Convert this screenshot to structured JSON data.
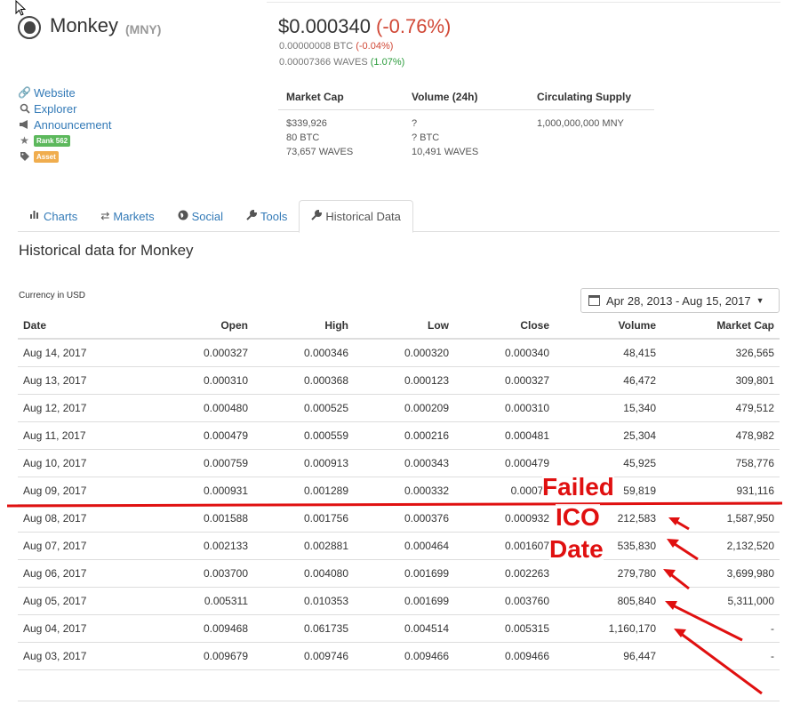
{
  "coin": {
    "name": "Monkey",
    "symbol": "(MNY)",
    "price": "$0.000340",
    "price_change": "(-0.76%)",
    "btc_price": "0.00000008 BTC",
    "btc_change": "(-0.04%)",
    "waves_price": "0.00007366 WAVES",
    "waves_change": "(1.07%)"
  },
  "links": {
    "website": "Website",
    "explorer": "Explorer",
    "announcement": "Announcement",
    "rank": "Rank 562",
    "asset": "Asset"
  },
  "stats": {
    "headers": [
      "Market Cap",
      "Volume (24h)",
      "Circulating Supply"
    ],
    "market_cap": [
      "$339,926",
      "80 BTC",
      "73,657 WAVES"
    ],
    "volume": [
      "?",
      "? BTC",
      "10,491 WAVES"
    ],
    "supply": [
      "1,000,000,000 MNY"
    ]
  },
  "tabs": {
    "charts": "Charts",
    "markets": "Markets",
    "social": "Social",
    "tools": "Tools",
    "historical": "Historical Data"
  },
  "historical": {
    "title": "Historical data for Monkey",
    "currency": "Currency in USD",
    "date_range": "Apr 28, 2013 - Aug 15, 2017",
    "columns": [
      "Date",
      "Open",
      "High",
      "Low",
      "Close",
      "Volume",
      "Market Cap"
    ],
    "rows": [
      [
        "Aug 14, 2017",
        "0.000327",
        "0.000346",
        "0.000320",
        "0.000340",
        "48,415",
        "326,565"
      ],
      [
        "Aug 13, 2017",
        "0.000310",
        "0.000368",
        "0.000123",
        "0.000327",
        "46,472",
        "309,801"
      ],
      [
        "Aug 12, 2017",
        "0.000480",
        "0.000525",
        "0.000209",
        "0.000310",
        "15,340",
        "479,512"
      ],
      [
        "Aug 11, 2017",
        "0.000479",
        "0.000559",
        "0.000216",
        "0.000481",
        "25,304",
        "478,982"
      ],
      [
        "Aug 10, 2017",
        "0.000759",
        "0.000913",
        "0.000343",
        "0.000479",
        "45,925",
        "758,776"
      ],
      [
        "Aug 09, 2017",
        "0.000931",
        "0.001289",
        "0.000332",
        "0.00076",
        "59,819",
        "931,116"
      ],
      [
        "Aug 08, 2017",
        "0.001588",
        "0.001756",
        "0.000376",
        "0.000932",
        "212,583",
        "1,587,950"
      ],
      [
        "Aug 07, 2017",
        "0.002133",
        "0.002881",
        "0.000464",
        "0.001607",
        "535,830",
        "2,132,520"
      ],
      [
        "Aug 06, 2017",
        "0.003700",
        "0.004080",
        "0.001699",
        "0.002263",
        "279,780",
        "3,699,980"
      ],
      [
        "Aug 05, 2017",
        "0.005311",
        "0.010353",
        "0.001699",
        "0.003760",
        "805,840",
        "5,311,000"
      ],
      [
        "Aug 04, 2017",
        "0.009468",
        "0.061735",
        "0.004514",
        "0.005315",
        "1,160,170",
        "-"
      ],
      [
        "Aug 03, 2017",
        "0.009679",
        "0.009746",
        "0.009466",
        "0.009466",
        "96,447",
        "-"
      ]
    ]
  },
  "annotation": {
    "line1": "Failed",
    "line2": "ICO",
    "line3": "Date",
    "color": "#e01010"
  }
}
